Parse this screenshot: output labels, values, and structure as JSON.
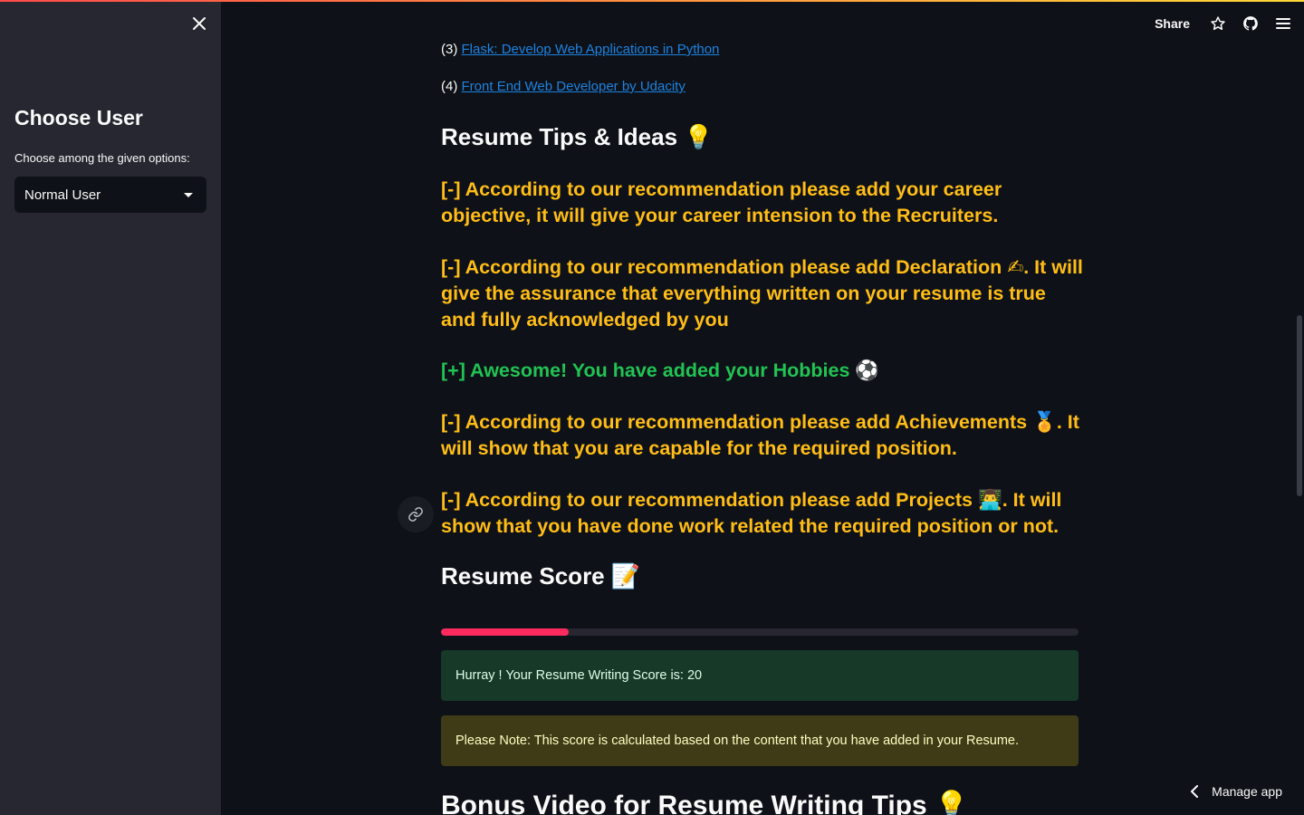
{
  "sidebar": {
    "title": "Choose User",
    "select_label": "Choose among the given options:",
    "selected_option": "Normal User"
  },
  "toolbar": {
    "share_label": "Share",
    "icons": [
      "star-icon",
      "github-icon",
      "menu-icon"
    ]
  },
  "courses": [
    {
      "index": "(3)",
      "title": "Flask: Develop Web Applications in Python"
    },
    {
      "index": "(4)",
      "title": "Front End Web Developer by Udacity"
    }
  ],
  "tips": {
    "heading": "Resume Tips & Ideas",
    "heading_emoji": "💡",
    "items": [
      {
        "status": "warn",
        "text": "[-] According to our recommendation please add your career objective, it will give your career intension to the Recruiters."
      },
      {
        "status": "warn",
        "text": "[-] According to our recommendation please add Declaration ✍. It will give the assurance that everything written on your resume is true and fully acknowledged by you"
      },
      {
        "status": "good",
        "text": "[+] Awesome! You have added your Hobbies ⚽"
      },
      {
        "status": "warn",
        "text": "[-] According to our recommendation please add Achievements 🏅. It will show that you are capable for the required position."
      },
      {
        "status": "warn",
        "text": "[-] According to our recommendation please add Projects 👨‍💻. It will show that you have done work related the required position or not."
      }
    ]
  },
  "score": {
    "heading": "Resume Score",
    "heading_emoji": "📝",
    "progress_percent": 20,
    "success_message": "Hurray ! Your Resume Writing Score is: 20",
    "note_message": "Please Note: This score is calculated based on the content that you have added in your Resume."
  },
  "bonus": {
    "heading": "Bonus Video for Resume Writing Tips",
    "heading_emoji": "💡"
  },
  "footer": {
    "manage_app_label": "Manage app"
  },
  "colors": {
    "warn": "#ffbd16",
    "good": "#21c354",
    "progress": "#ff2b5e",
    "link": "#1c83e1"
  }
}
